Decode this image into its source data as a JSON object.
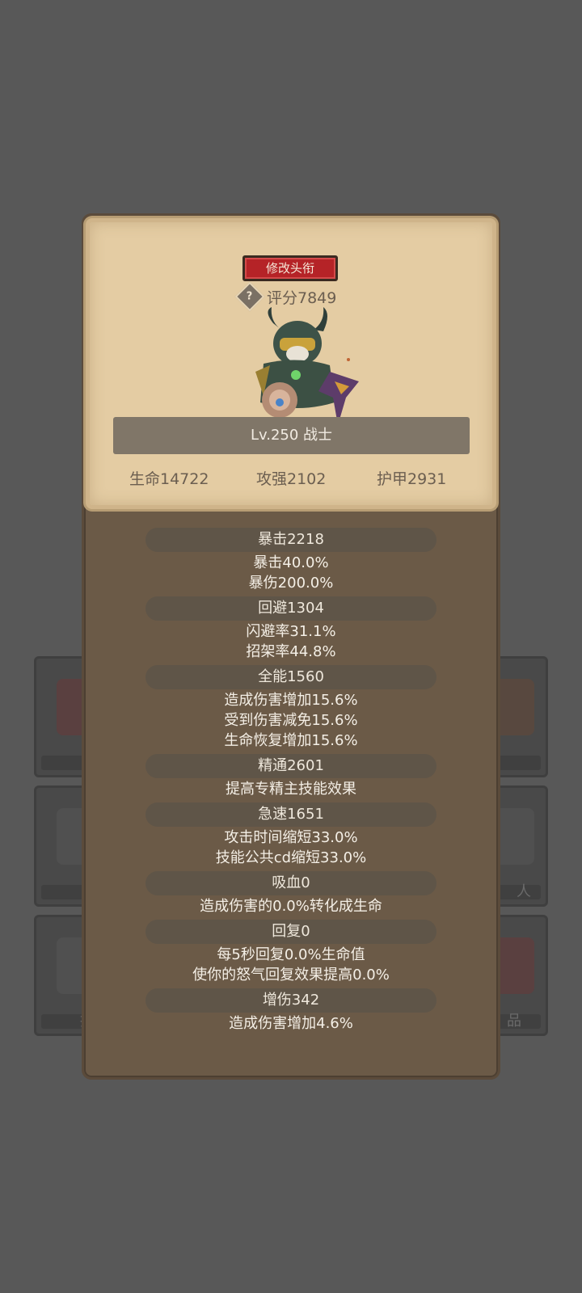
{
  "card": {
    "title_button": "修改头衔",
    "help_icon": "?",
    "score": "评分7849",
    "level_class": "Lv.250 战士",
    "stats": [
      "生命14722",
      "攻强2102",
      "护甲2931"
    ]
  },
  "attributes": [
    {
      "name": "暴击2218",
      "lines": [
        "暴击40.0%",
        "暴伤200.0%"
      ]
    },
    {
      "name": "回避1304",
      "lines": [
        "闪避率31.1%",
        "招架率44.8%"
      ]
    },
    {
      "name": "全能1560",
      "lines": [
        "造成伤害增加15.6%",
        "受到伤害减免15.6%",
        "生命恢复增加15.6%"
      ]
    },
    {
      "name": "精通2601",
      "lines": [
        "提高专精主技能效果"
      ]
    },
    {
      "name": "急速1651",
      "lines": [
        "攻击时间缩短33.0%",
        "技能公共cd缩短33.0%"
      ]
    },
    {
      "name": "吸血0",
      "lines": [
        "造成伤害的0.0%转化成生命"
      ]
    },
    {
      "name": "回复0",
      "lines": [
        "每5秒回复0.0%生命值",
        "使你的怒气回复效果提高0.0%"
      ]
    },
    {
      "name": "增伤342",
      "lines": [
        "造成伤害增加4.6%"
      ]
    }
  ],
  "background_tiles": {
    "row1_right": "",
    "row2_right": "人",
    "row3_left": "抗",
    "row3_right": "品"
  }
}
